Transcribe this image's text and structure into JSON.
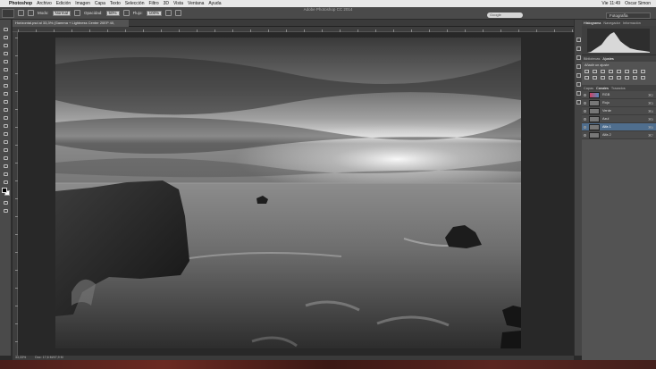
{
  "menubar": {
    "app": "Photoshop",
    "items": [
      "Archivo",
      "Edición",
      "Imagen",
      "Capa",
      "Texto",
      "Selección",
      "Filtro",
      "3D",
      "Vista",
      "Ventana",
      "Ayuda"
    ],
    "user": "Oscar Simon",
    "time": "Vie 11:49"
  },
  "app_title": "Adobe Photoshop CC 2014",
  "options": {
    "mode_label": "Modo:",
    "mode_value": "Normal",
    "opacity_label": "Opacidad:",
    "opacity_value": "50%",
    "flow_label": "Flujo:",
    "flow_value": "100%"
  },
  "search": {
    "placeholder": "Google"
  },
  "workspace": "Fotografía",
  "document": {
    "tab": "Horizontal.psd al 33,3% (Gamma + Lightness Center 20EP 40, RGB/8*) *"
  },
  "status": {
    "zoom": "33,33%",
    "doc_size": "Doc: 17,6 M/47,9 M"
  },
  "panels": {
    "top_tabs": [
      "Histograma",
      "Navegador",
      "Información"
    ],
    "adjust_tabs": [
      "Bibliotecas",
      "Ajustes"
    ],
    "adjust_title": "Añadir un ajuste",
    "layer_tabs": [
      "Capas",
      "Canales",
      "Trazados"
    ],
    "channels": [
      {
        "name": "RGB",
        "key": "⌘2"
      },
      {
        "name": "Rojo",
        "key": "⌘3"
      },
      {
        "name": "Verde",
        "key": "⌘4"
      },
      {
        "name": "Azul",
        "key": "⌘5"
      },
      {
        "name": "Alfa 1",
        "key": "⌘6"
      },
      {
        "name": "Alfa 2",
        "key": "⌘7"
      }
    ]
  },
  "colors": {
    "selected_row": "#4f6e8e",
    "ui_dark": "#2a2a2a",
    "panel": "#535353"
  }
}
